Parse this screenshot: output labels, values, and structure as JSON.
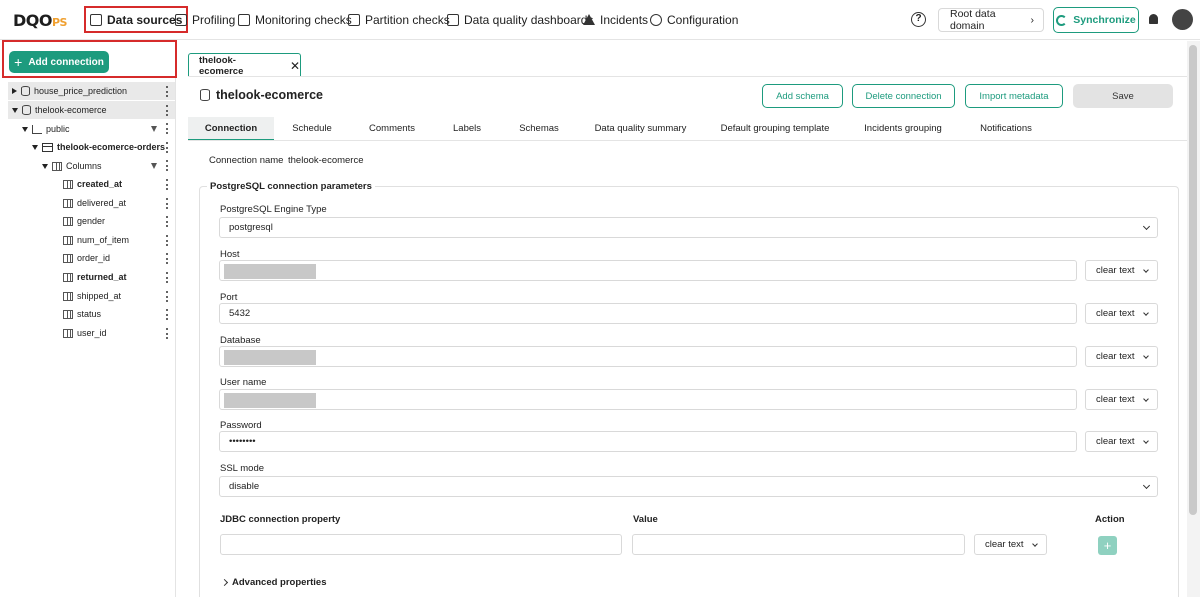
{
  "nav": {
    "logo_main": "DQO",
    "logo_suffix": "PS",
    "items": [
      {
        "label": "Data sources",
        "icon": "datasource-icon"
      },
      {
        "label": "Profiling",
        "icon": "profiling-icon"
      },
      {
        "label": "Monitoring checks",
        "icon": "monitoring-icon"
      },
      {
        "label": "Partition checks",
        "icon": "partition-icon"
      },
      {
        "label": "Data quality dashboards",
        "icon": "dashboard-icon"
      },
      {
        "label": "Incidents",
        "icon": "warning-icon"
      },
      {
        "label": "Configuration",
        "icon": "gear-icon"
      }
    ],
    "help": "?",
    "root_domain": "Root data domain",
    "sync": "Synchronize"
  },
  "sidebar": {
    "add_connection": "Add connection",
    "tree": [
      {
        "label": "house_price_prediction"
      },
      {
        "label": "thelook-ecomerce"
      },
      {
        "label": "public"
      },
      {
        "label": "thelook-ecomerce-orders"
      },
      {
        "label": "Columns"
      },
      {
        "label": "created_at"
      },
      {
        "label": "delivered_at"
      },
      {
        "label": "gender"
      },
      {
        "label": "num_of_item"
      },
      {
        "label": "order_id"
      },
      {
        "label": "returned_at"
      },
      {
        "label": "shipped_at"
      },
      {
        "label": "status"
      },
      {
        "label": "user_id"
      }
    ]
  },
  "main": {
    "open_tab": "thelook-ecomerce",
    "title": "thelook-ecomerce",
    "buttons": {
      "add_schema": "Add schema",
      "delete_connection": "Delete connection",
      "import_metadata": "Import metadata",
      "save": "Save"
    },
    "tabs": [
      "Connection",
      "Schedule",
      "Comments",
      "Labels",
      "Schemas",
      "Data quality summary",
      "Default grouping template",
      "Incidents grouping",
      "Notifications"
    ],
    "connection_name_label": "Connection name",
    "connection_name_value": "thelook-ecomerce",
    "section_title": "PostgreSQL connection parameters",
    "engine_label": "PostgreSQL Engine Type",
    "engine_value": "postgresql",
    "host_label": "Host",
    "port_label": "Port",
    "port_value": "5432",
    "database_label": "Database",
    "username_label": "User name",
    "password_label": "Password",
    "password_value": "••••••••",
    "ssl_label": "SSL mode",
    "ssl_value": "disable",
    "clear_text": "clear text",
    "jdbc_label": "JDBC connection property",
    "value_label": "Value",
    "action_label": "Action",
    "advanced": "Advanced properties"
  },
  "colors": {
    "accent": "#1d9b7e",
    "highlight": "#d62b2b"
  }
}
